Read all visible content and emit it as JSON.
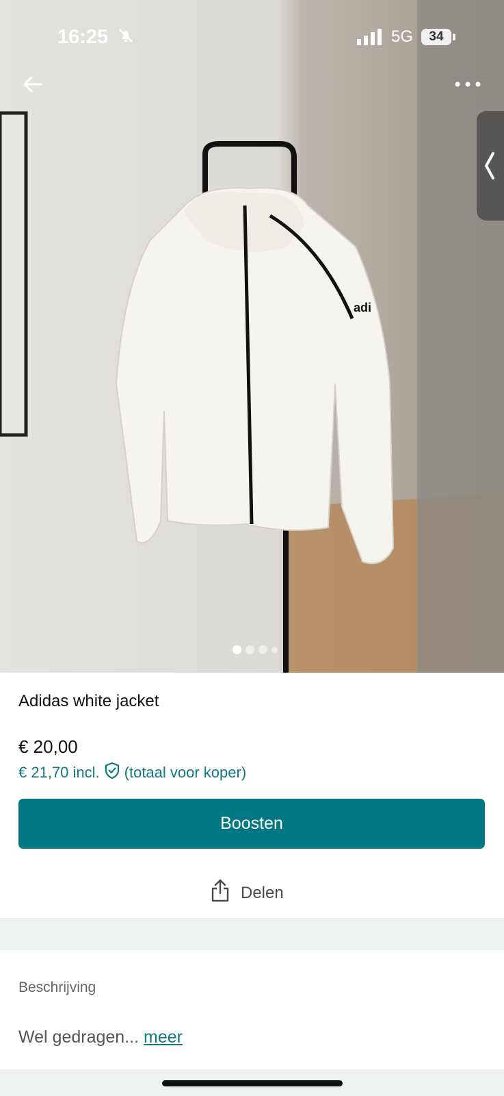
{
  "status": {
    "time": "16:25",
    "network": "5G",
    "battery": "34"
  },
  "gallery": {
    "image_count": 4,
    "active_index": 0
  },
  "product": {
    "title": "Adidas white jacket",
    "price": "€ 20,00",
    "price_incl": "€ 21,70 incl.",
    "price_incl_note": "(totaal voor koper)"
  },
  "actions": {
    "boost_label": "Boosten",
    "share_label": "Delen"
  },
  "description": {
    "label": "Beschrijving",
    "text": "Wel gedragen...",
    "more_label": "meer"
  },
  "colors": {
    "accent": "#007782",
    "link": "#0f7a82"
  },
  "icons": [
    "bell-slash-icon",
    "signal-icon",
    "battery-icon",
    "back-arrow-icon",
    "more-dots-icon",
    "chevron-left-icon",
    "shield-check-icon",
    "share-icon"
  ]
}
